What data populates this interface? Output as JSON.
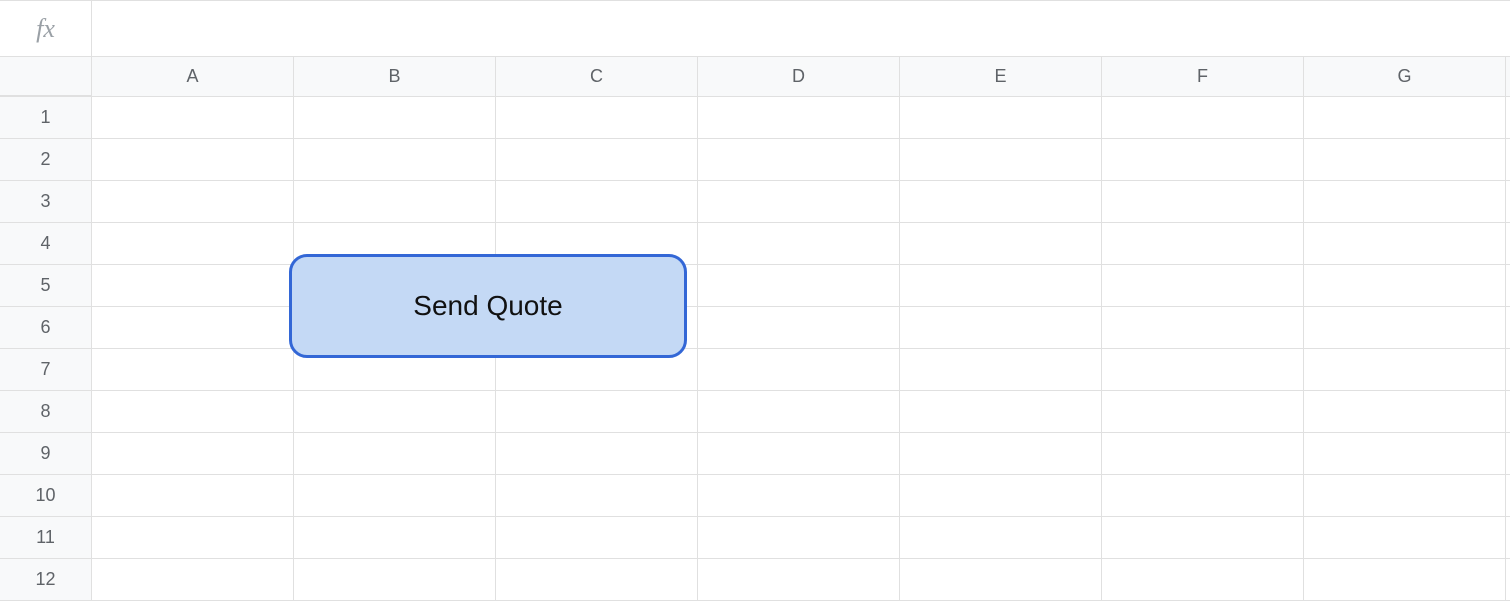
{
  "formula_bar": {
    "fx_label": "fx",
    "value": ""
  },
  "columns": [
    "A",
    "B",
    "C",
    "D",
    "E",
    "F",
    "G"
  ],
  "rows": [
    "1",
    "2",
    "3",
    "4",
    "5",
    "6",
    "7",
    "8",
    "9",
    "10",
    "11",
    "12"
  ],
  "drawing": {
    "label": "Send Quote"
  },
  "colors": {
    "button_fill": "#c4d9f5",
    "button_border": "#3367d6",
    "header_bg": "#f8f9fa",
    "grid_line": "#e0e0e0"
  }
}
